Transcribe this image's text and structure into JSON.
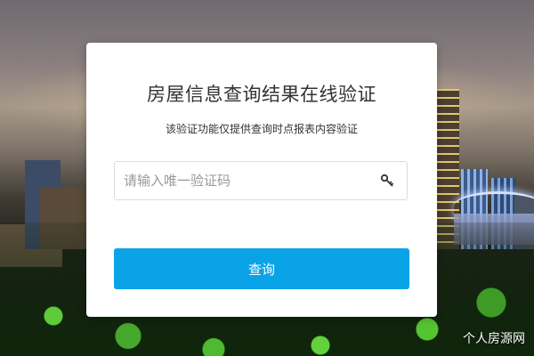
{
  "card": {
    "title": "房屋信息查询结果在线验证",
    "subtitle": "该验证功能仅提供查询时点报表内容验证",
    "input": {
      "placeholder": "请输入唯一验证码",
      "value": "",
      "icon": "key-icon"
    },
    "query_button_label": "查询",
    "accent_color": "#0aa3e8"
  },
  "watermark": "个人房源网"
}
